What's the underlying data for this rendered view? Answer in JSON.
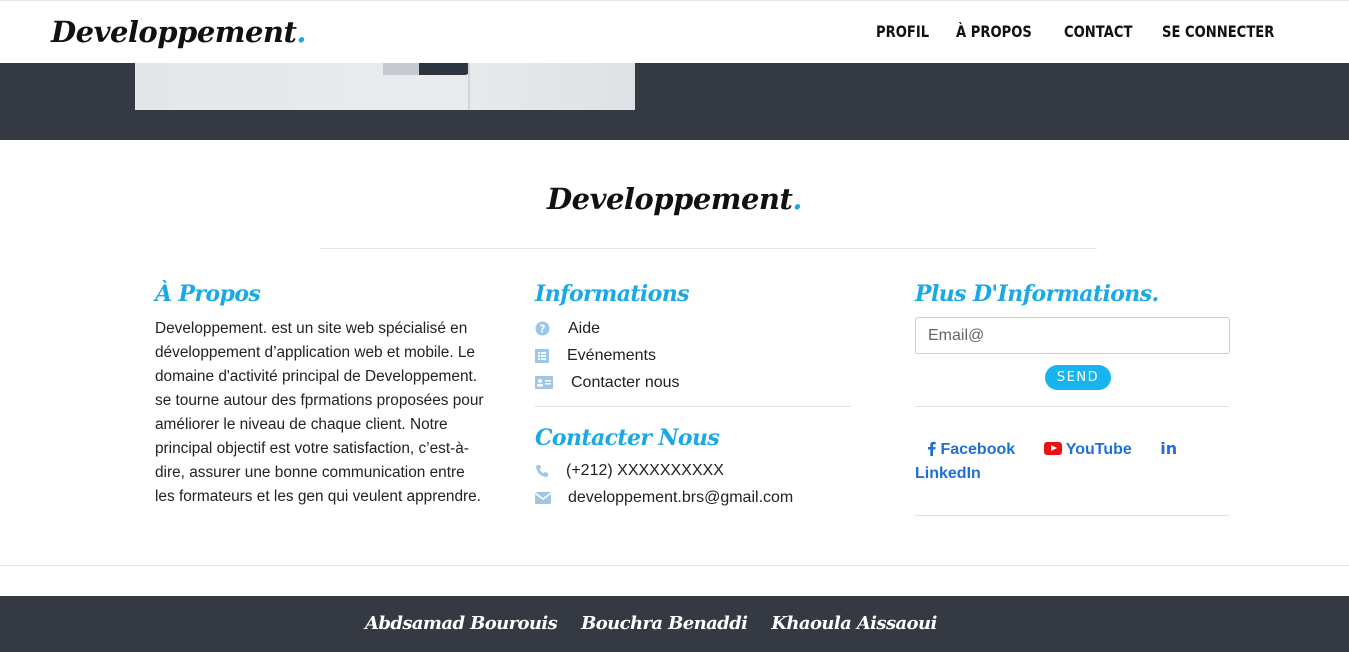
{
  "navbar": {
    "brand": "Developpement",
    "brand_dot": ".",
    "links": [
      "PROFIL",
      "À PROPOS",
      "CONTACT",
      "SE CONNECTER"
    ]
  },
  "footer": {
    "brand": "Developpement",
    "brand_dot": ".",
    "about": {
      "heading": "À Propos",
      "text": "Developpement. est un site web spécialisé en développement d’application web et mobile. Le domaine d'activité principal de Developpement. se tourne autour des fprmations proposées pour améliorer le niveau de chaque client. Notre principal objectif est votre satisfaction, c’est-à-dire, assurer une bonne communication entre les formateurs et les gen qui veulent apprendre."
    },
    "informations": {
      "heading": "Informations",
      "items": [
        {
          "icon": "question-circle-icon",
          "label": "Aide"
        },
        {
          "icon": "list-icon",
          "label": "Evénements"
        },
        {
          "icon": "id-card-icon",
          "label": "Contacter nous"
        }
      ]
    },
    "contacter": {
      "heading": "Contacter Nous",
      "phone": "(+212) XXXXXXXXXX",
      "email": "developpement.brs@gmail.com"
    },
    "plus": {
      "heading": "Plus D'Informations.",
      "email_placeholder": "Email@",
      "send_label": "SEND",
      "social": [
        {
          "icon": "facebook-icon",
          "label": "Facebook"
        },
        {
          "icon": "youtube-icon",
          "label": "YouTube"
        },
        {
          "icon": "linkedin-icon",
          "label": "LinkedIn"
        }
      ]
    }
  },
  "credits": [
    "Abdsamad Bourouis",
    "Bouchra Benaddi",
    "Khaoula Aissaoui"
  ],
  "colors": {
    "accent": "#1aa9e6",
    "dark_band": "#353a42",
    "send_button": "#17b4f0",
    "social_link": "#1f6fd6",
    "youtube": "#ee1111"
  }
}
